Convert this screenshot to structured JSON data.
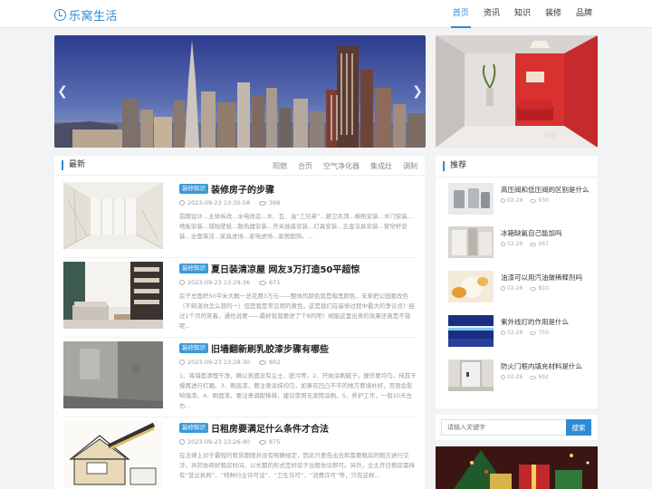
{
  "header": {
    "logo_text": "乐窝生活",
    "nav": [
      "首页",
      "资讯",
      "知识",
      "装修",
      "品牌"
    ]
  },
  "main": {
    "title": "最新",
    "tags": [
      "阳燃",
      "合页",
      "空气净化器",
      "集成灶",
      "调制"
    ],
    "articles": [
      {
        "badge": "装修知识",
        "title": "装修房子的步骤",
        "date": "2023-09-23 13:30:58",
        "views": "396",
        "summary": "前期设计...主体拆改...水电改造...木、瓦、油“三兄弟”...厨卫吊顶...橱柜安装...木门安装...地板安装...铺贴壁纸...散热器安装...开关插座安装...灯具安装...五金洁具安装...窗帘杆安装...全面保洁...家具进场...家电进场...家居配饰。..."
      },
      {
        "badge": "装修知识",
        "title": "夏日装清凉屋 网友3万打造50平超惊",
        "date": "2023-09-23 13:29:36",
        "views": "671",
        "summary": "房子总面积50平米大概一总花费3万元——整体的颜色就是暗黑颜色，未来把公园要改色（不知道你怎么想的一）但是我是常见用的黄色，这是我们在装修过程中最大的争议点！经过1个月的笑着，通也说要——最好就我要进了个8的吧！相能这里出来的效果还真是不错呢..."
      },
      {
        "badge": "装修知识",
        "title": "旧墙翻新刷乳胶漆步骤有哪些",
        "date": "2023-09-23 13:28:30",
        "views": "802",
        "summary": "1、将墙面清理干净，确认表面没有尘土、脏污等。2、开始涂刷腻子，操作要均匀，待其干燥再进行打磨。3、刷底漆，要注意涂抹均匀，如果有凹凸不平的地方要填补好，否则会影响墙漆。4、刷面漆，要注意调配稀释，建议使用无滚筒涂刷。5、养护工作，一般10天左右..."
      },
      {
        "badge": "装修知识",
        "title": "日租房要满足什么条件才合法",
        "date": "2023-09-23 13:26:40",
        "views": "875",
        "summary": "在法律上对于最短的租赁期限并没有明确规定，因此只要告出去和需要租房的租方进行交涉，并同协商好租房时间，以长期的形式签好房子出租协议即可。另外，业主开日租房需持有“营业执照”、“特种行业许可证”、“卫生许可”、“消费许可”等，只有这样..."
      }
    ]
  },
  "recommend": {
    "title": "推荐",
    "items": [
      {
        "name": "高压阀和低压阀的区别是什么",
        "date": "02-26",
        "views": "930"
      },
      {
        "name": "冰箱缺氟自己能加吗",
        "date": "02-26",
        "views": "667"
      },
      {
        "name": "油漆可以用汽油做稀释剂吗",
        "date": "02-26",
        "views": "810"
      },
      {
        "name": "紫外线灯的作用是什么",
        "date": "02-26",
        "views": "755"
      },
      {
        "name": "防火门框内填充材料是什么",
        "date": "02-26",
        "views": "692"
      }
    ]
  },
  "search": {
    "placeholder": "请输入关键字",
    "button": "搜索"
  }
}
